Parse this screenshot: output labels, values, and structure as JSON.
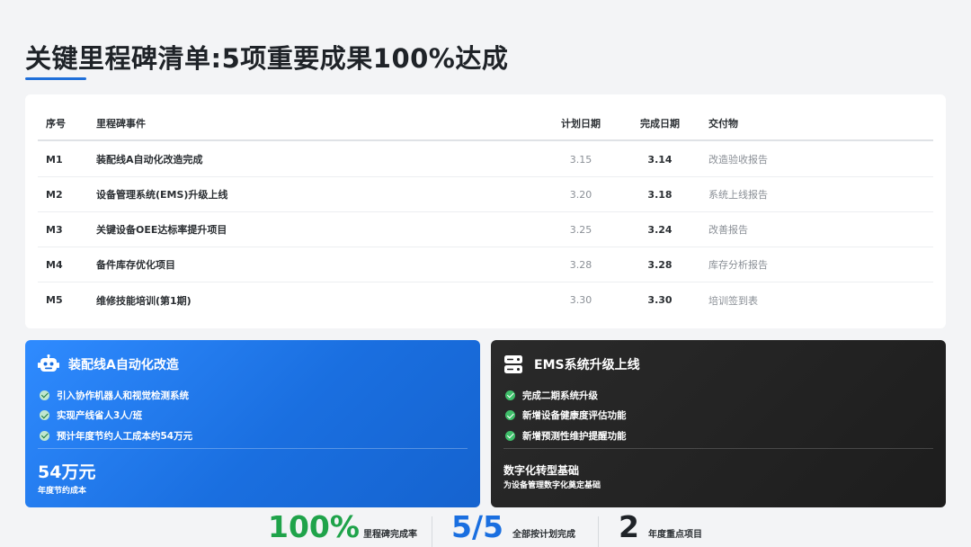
{
  "title": "关键里程碑清单:5项重要成果100%达成",
  "table": {
    "headers": {
      "id": "序号",
      "name": "里程碑事件",
      "plan": "计划日期",
      "done": "完成日期",
      "deliverable": "交付物"
    },
    "rows": [
      {
        "id": "M1",
        "name": "装配线A自动化改造完成",
        "plan": "3.15",
        "done": "3.14",
        "deliverable": "改造验收报告"
      },
      {
        "id": "M2",
        "name": "设备管理系统(EMS)升级上线",
        "plan": "3.20",
        "done": "3.18",
        "deliverable": "系统上线报告"
      },
      {
        "id": "M3",
        "name": "关键设备OEE达标率提升项目",
        "plan": "3.25",
        "done": "3.24",
        "deliverable": "改善报告"
      },
      {
        "id": "M4",
        "name": "备件库存优化项目",
        "plan": "3.28",
        "done": "3.28",
        "deliverable": "库存分析报告"
      },
      {
        "id": "M5",
        "name": "维修技能培训(第1期)",
        "plan": "3.30",
        "done": "3.30",
        "deliverable": "培训签到表"
      }
    ]
  },
  "card_blue": {
    "icon": "robot-icon",
    "title": "装配线A自动化改造",
    "bullets": [
      "引入协作机器人和视觉检测系统",
      "实现产线省人3人/班",
      "预计年度节约人工成本约54万元"
    ],
    "value": "54万元",
    "caption": "年度节约成本"
  },
  "card_dark": {
    "icon": "server-icon",
    "title": "EMS系统升级上线",
    "bullets": [
      "完成二期系统升级",
      "新增设备健康度评估功能",
      "新增预测性维护提醒功能"
    ],
    "heading": "数字化转型基础",
    "caption": "为设备管理数字化奠定基础"
  },
  "stats": [
    {
      "value": "100%",
      "label": "里程碑完成率",
      "color": "#1fa34a"
    },
    {
      "value": "5/5",
      "label": "全部按计划完成",
      "color": "#1a6fe0"
    },
    {
      "value": "2",
      "label": "年度重点项目",
      "color": "#1f2328"
    }
  ]
}
